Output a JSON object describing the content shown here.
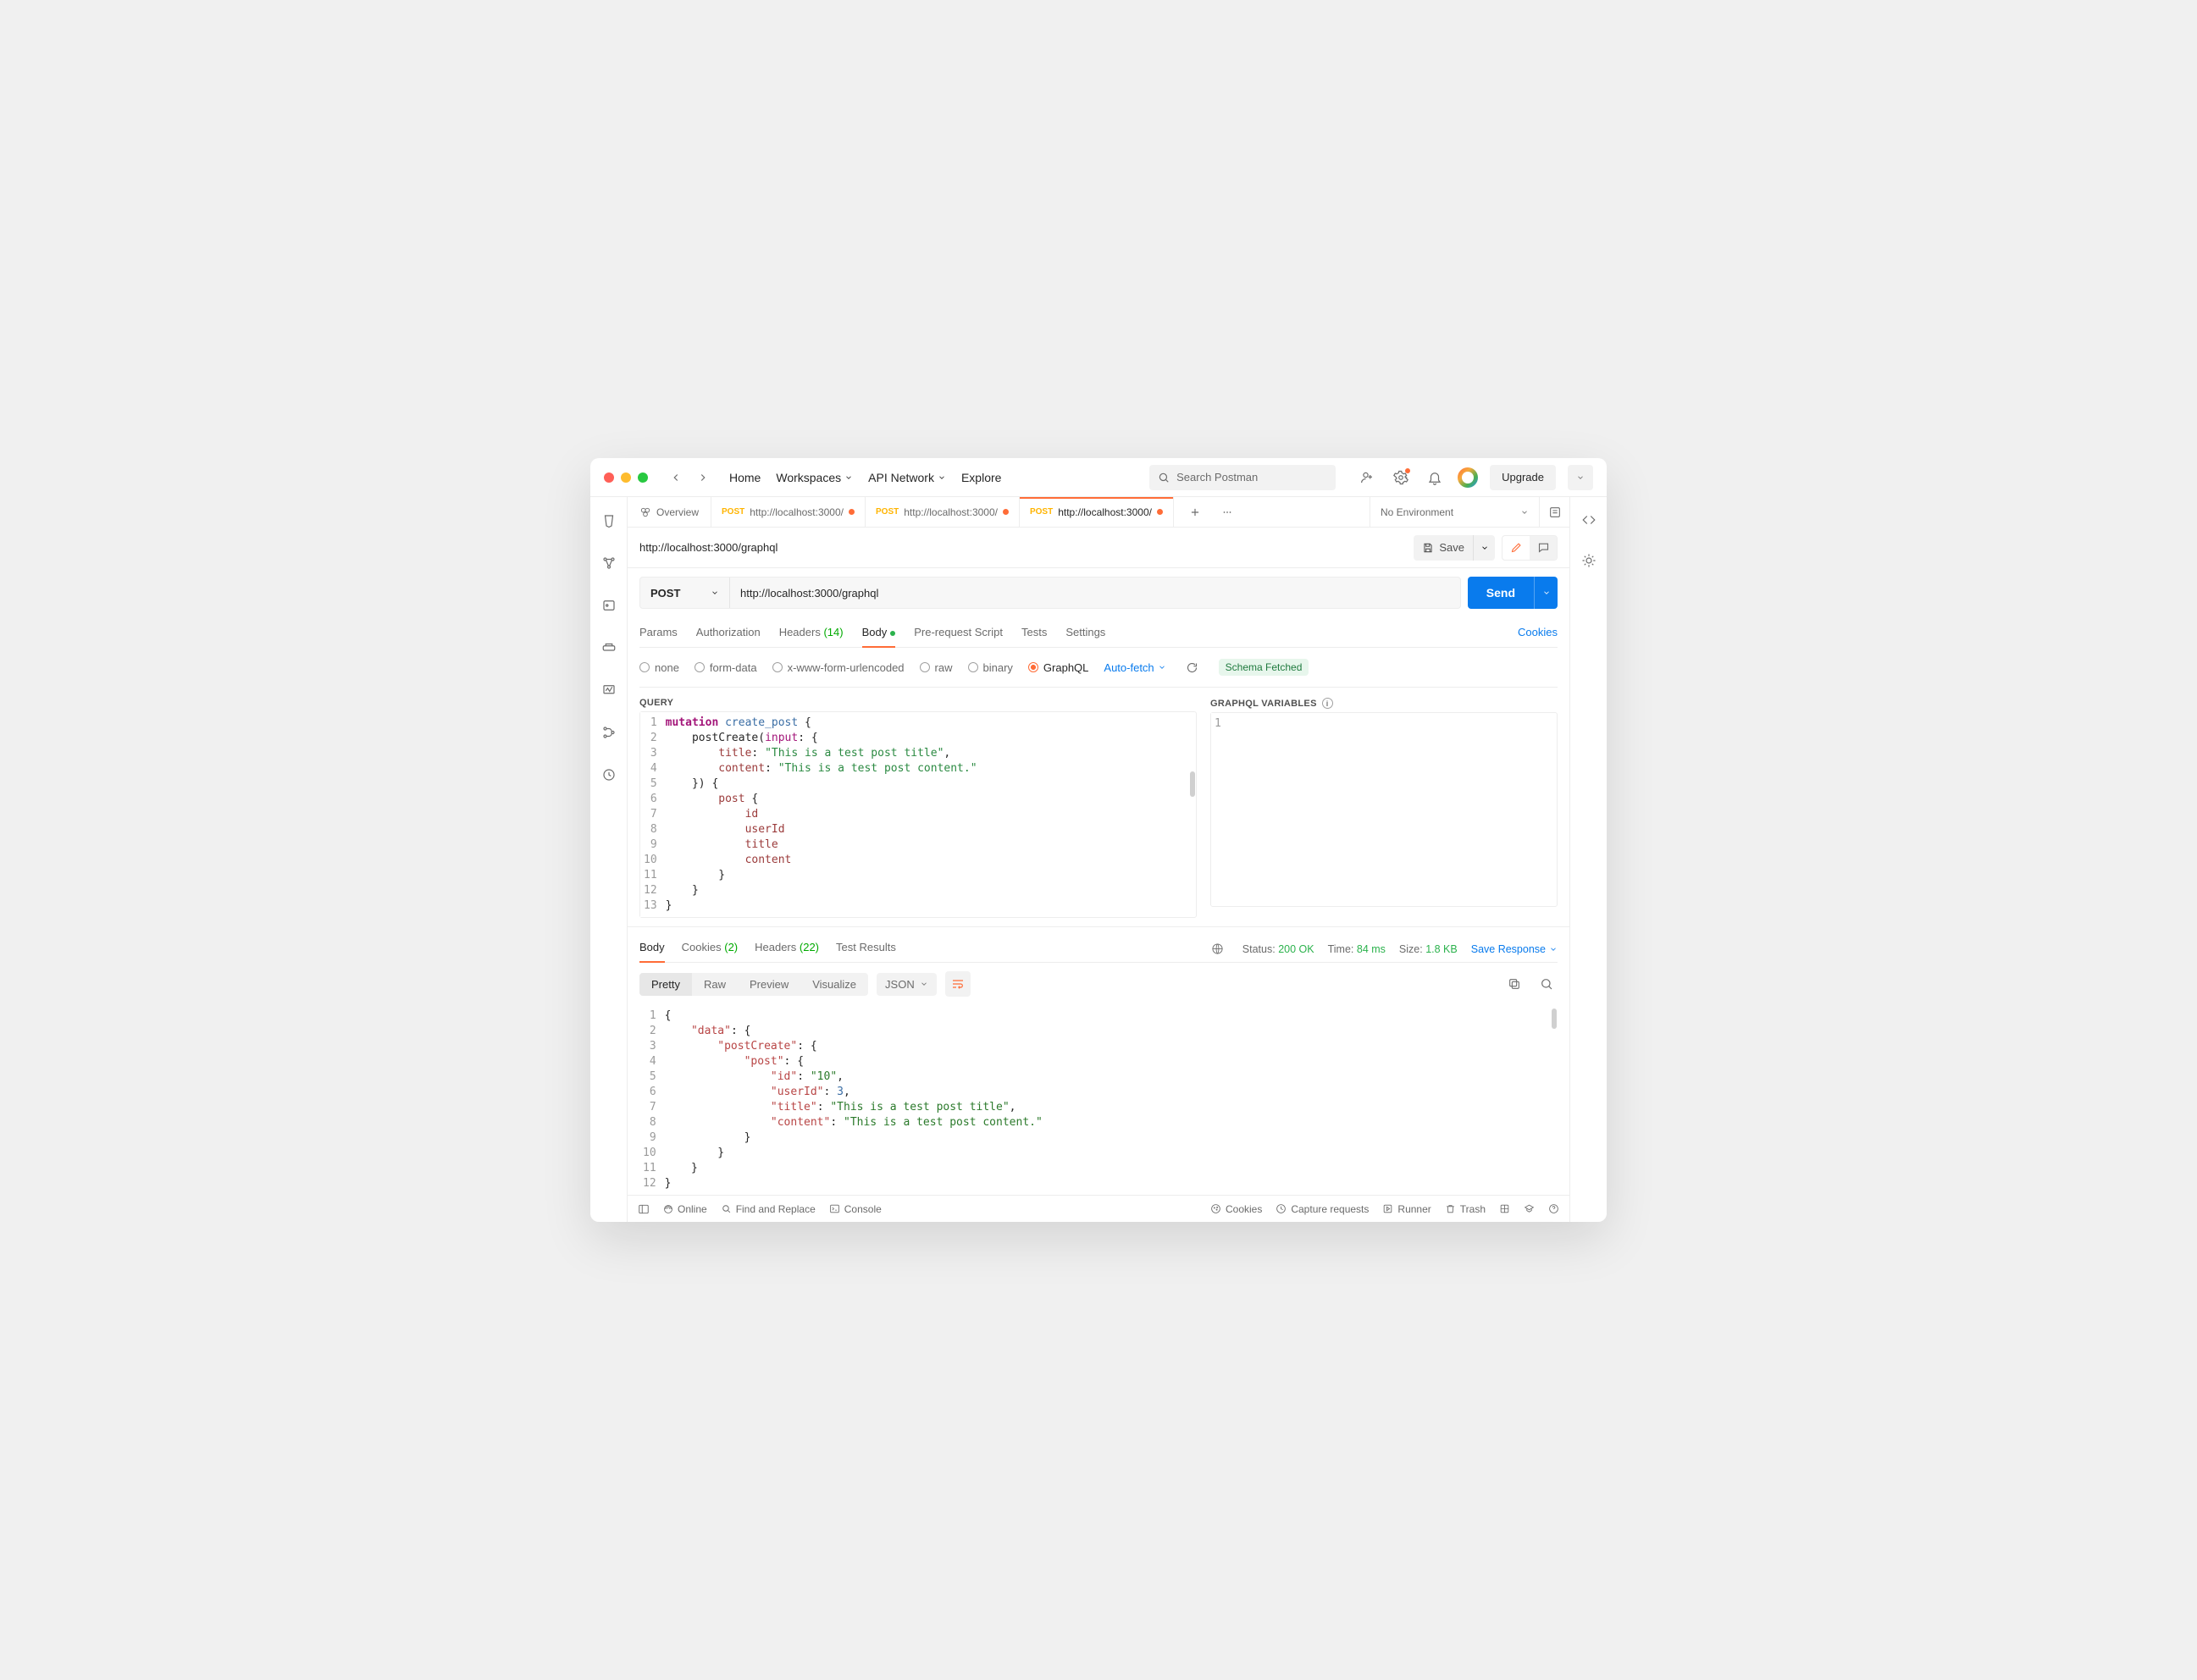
{
  "topnav": {
    "home": "Home",
    "workspaces": "Workspaces",
    "api_network": "API Network",
    "explore": "Explore",
    "search_placeholder": "Search Postman",
    "upgrade": "Upgrade"
  },
  "tabs": {
    "overview": "Overview",
    "list": [
      {
        "method": "POST",
        "label": "http://localhost:3000/",
        "active": false,
        "dirty": true
      },
      {
        "method": "POST",
        "label": "http://localhost:3000/",
        "active": false,
        "dirty": true
      },
      {
        "method": "POST",
        "label": "http://localhost:3000/",
        "active": true,
        "dirty": true
      }
    ],
    "env": "No Environment"
  },
  "request": {
    "title": "http://localhost:3000/graphql",
    "save": "Save",
    "method": "POST",
    "url": "http://localhost:3000/graphql",
    "send": "Send"
  },
  "subtabs": {
    "params": "Params",
    "auth": "Authorization",
    "headers": "Headers",
    "headers_count": "(14)",
    "body": "Body",
    "prereq": "Pre-request Script",
    "tests": "Tests",
    "settings": "Settings",
    "cookies": "Cookies"
  },
  "bodytypes": {
    "none": "none",
    "form": "form-data",
    "xform": "x-www-form-urlencoded",
    "raw": "raw",
    "binary": "binary",
    "graphql": "GraphQL",
    "autofetch": "Auto-fetch",
    "schema": "Schema Fetched"
  },
  "query_label": "QUERY",
  "vars_label": "GRAPHQL VARIABLES",
  "query_lines": [
    {
      "n": "1",
      "html": "<span class='tk-kw'>mutation</span> <span class='tk-name'>create_post</span> {"
    },
    {
      "n": "2",
      "html": "    postCreate(<span class='tk-arg'>input</span>: {"
    },
    {
      "n": "3",
      "html": "        <span class='tk-field'>title</span>: <span class='tk-str'>\"This is a test post title\"</span>,"
    },
    {
      "n": "4",
      "html": "        <span class='tk-field'>content</span>: <span class='tk-str'>\"This is a test post content.\"</span>"
    },
    {
      "n": "5",
      "html": "    }) {"
    },
    {
      "n": "6",
      "html": "        <span class='tk-field'>post</span> {"
    },
    {
      "n": "7",
      "html": "            <span class='tk-field'>id</span>"
    },
    {
      "n": "8",
      "html": "            <span class='tk-field'>userId</span>"
    },
    {
      "n": "9",
      "html": "            <span class='tk-field'>title</span>"
    },
    {
      "n": "10",
      "html": "            <span class='tk-field'>content</span>"
    },
    {
      "n": "11",
      "html": "        }"
    },
    {
      "n": "12",
      "html": "    }"
    },
    {
      "n": "13",
      "html": "}"
    }
  ],
  "vars_lines": [
    {
      "n": "1",
      "html": ""
    }
  ],
  "resp_tabs": {
    "body": "Body",
    "cookies": "Cookies",
    "cookies_count": "(2)",
    "headers": "Headers",
    "headers_count": "(22)",
    "tests": "Test Results"
  },
  "resp_meta": {
    "status_lbl": "Status:",
    "status_val": "200 OK",
    "time_lbl": "Time:",
    "time_val": "84 ms",
    "size_lbl": "Size:",
    "size_val": "1.8 KB",
    "save": "Save Response"
  },
  "resp_view": {
    "pretty": "Pretty",
    "raw": "Raw",
    "preview": "Preview",
    "visualize": "Visualize",
    "format": "JSON"
  },
  "resp_lines": [
    {
      "n": "1",
      "html": "<span class='tk-punc'>{</span>"
    },
    {
      "n": "2",
      "html": "    <span class='tk-key'>\"data\"</span><span class='tk-punc'>: {</span>"
    },
    {
      "n": "3",
      "html": "        <span class='tk-key'>\"postCreate\"</span><span class='tk-punc'>: {</span>"
    },
    {
      "n": "4",
      "html": "            <span class='tk-key'>\"post\"</span><span class='tk-punc'>: {</span>"
    },
    {
      "n": "5",
      "html": "                <span class='tk-key'>\"id\"</span><span class='tk-punc'>: </span><span class='tk-jstr'>\"10\"</span><span class='tk-punc'>,</span>"
    },
    {
      "n": "6",
      "html": "                <span class='tk-key'>\"userId\"</span><span class='tk-punc'>: </span><span class='tk-num'>3</span><span class='tk-punc'>,</span>"
    },
    {
      "n": "7",
      "html": "                <span class='tk-key'>\"title\"</span><span class='tk-punc'>: </span><span class='tk-jstr'>\"This is a test post title\"</span><span class='tk-punc'>,</span>"
    },
    {
      "n": "8",
      "html": "                <span class='tk-key'>\"content\"</span><span class='tk-punc'>: </span><span class='tk-jstr'>\"This is a test post content.\"</span>"
    },
    {
      "n": "9",
      "html": "            <span class='tk-punc'>}</span>"
    },
    {
      "n": "10",
      "html": "        <span class='tk-punc'>}</span>"
    },
    {
      "n": "11",
      "html": "    <span class='tk-punc'>}</span>"
    },
    {
      "n": "12",
      "html": "<span class='tk-punc'>}</span>"
    }
  ],
  "footer": {
    "online": "Online",
    "find": "Find and Replace",
    "console": "Console",
    "cookies": "Cookies",
    "capture": "Capture requests",
    "runner": "Runner",
    "trash": "Trash"
  }
}
